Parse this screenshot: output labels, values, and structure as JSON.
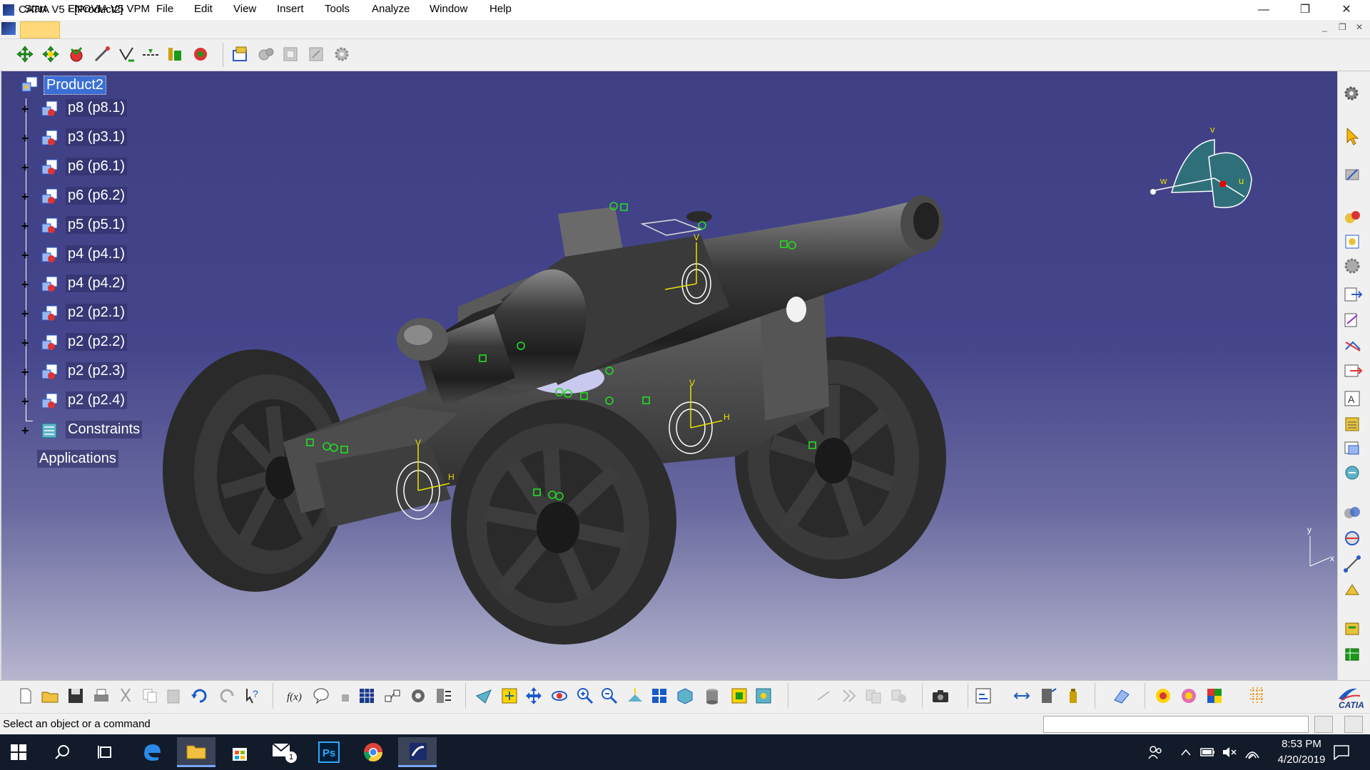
{
  "window": {
    "title": "CATIA V5 - [Product2]",
    "minimize": "—",
    "maximize": "❐",
    "close": "✕"
  },
  "menu": {
    "items": [
      "Start",
      "ENOVIA V5 VPM",
      "File",
      "Edit",
      "View",
      "Insert",
      "Tools",
      "Analyze",
      "Window",
      "Help"
    ],
    "mdi": [
      "_",
      "❐",
      "✕"
    ]
  },
  "tree": {
    "root": "Product2",
    "items": [
      "p8 (p8.1)",
      "p3 (p3.1)",
      "p6 (p6.1)",
      "p6 (p6.2)",
      "p5 (p5.1)",
      "p4 (p4.1)",
      "p4 (p4.2)",
      "p2 (p2.1)",
      "p2 (p2.2)",
      "p2 (p2.3)",
      "p2 (p2.4)"
    ],
    "constraints": "Constraints",
    "applications": "Applications"
  },
  "compass": {
    "v": "v",
    "w": "w",
    "u": "u"
  },
  "axis": {
    "y": "y",
    "x": "x"
  },
  "constraint_labels": {
    "v": "V",
    "h": "H"
  },
  "brand": {
    "catia": "CATIA"
  },
  "status": {
    "message": "Select an object or a command"
  },
  "taskbar": {
    "time": "8:53 PM",
    "date": "4/20/2019",
    "ps": "Ps",
    "mail_badge": "1"
  },
  "colors": {
    "viewport_top": "#3f3f84",
    "viewport_bottom": "#b6b6cf",
    "selection": "#3b6fd6",
    "constraint_green": "#22dd22",
    "constraint_yellow": "#e8e000"
  }
}
